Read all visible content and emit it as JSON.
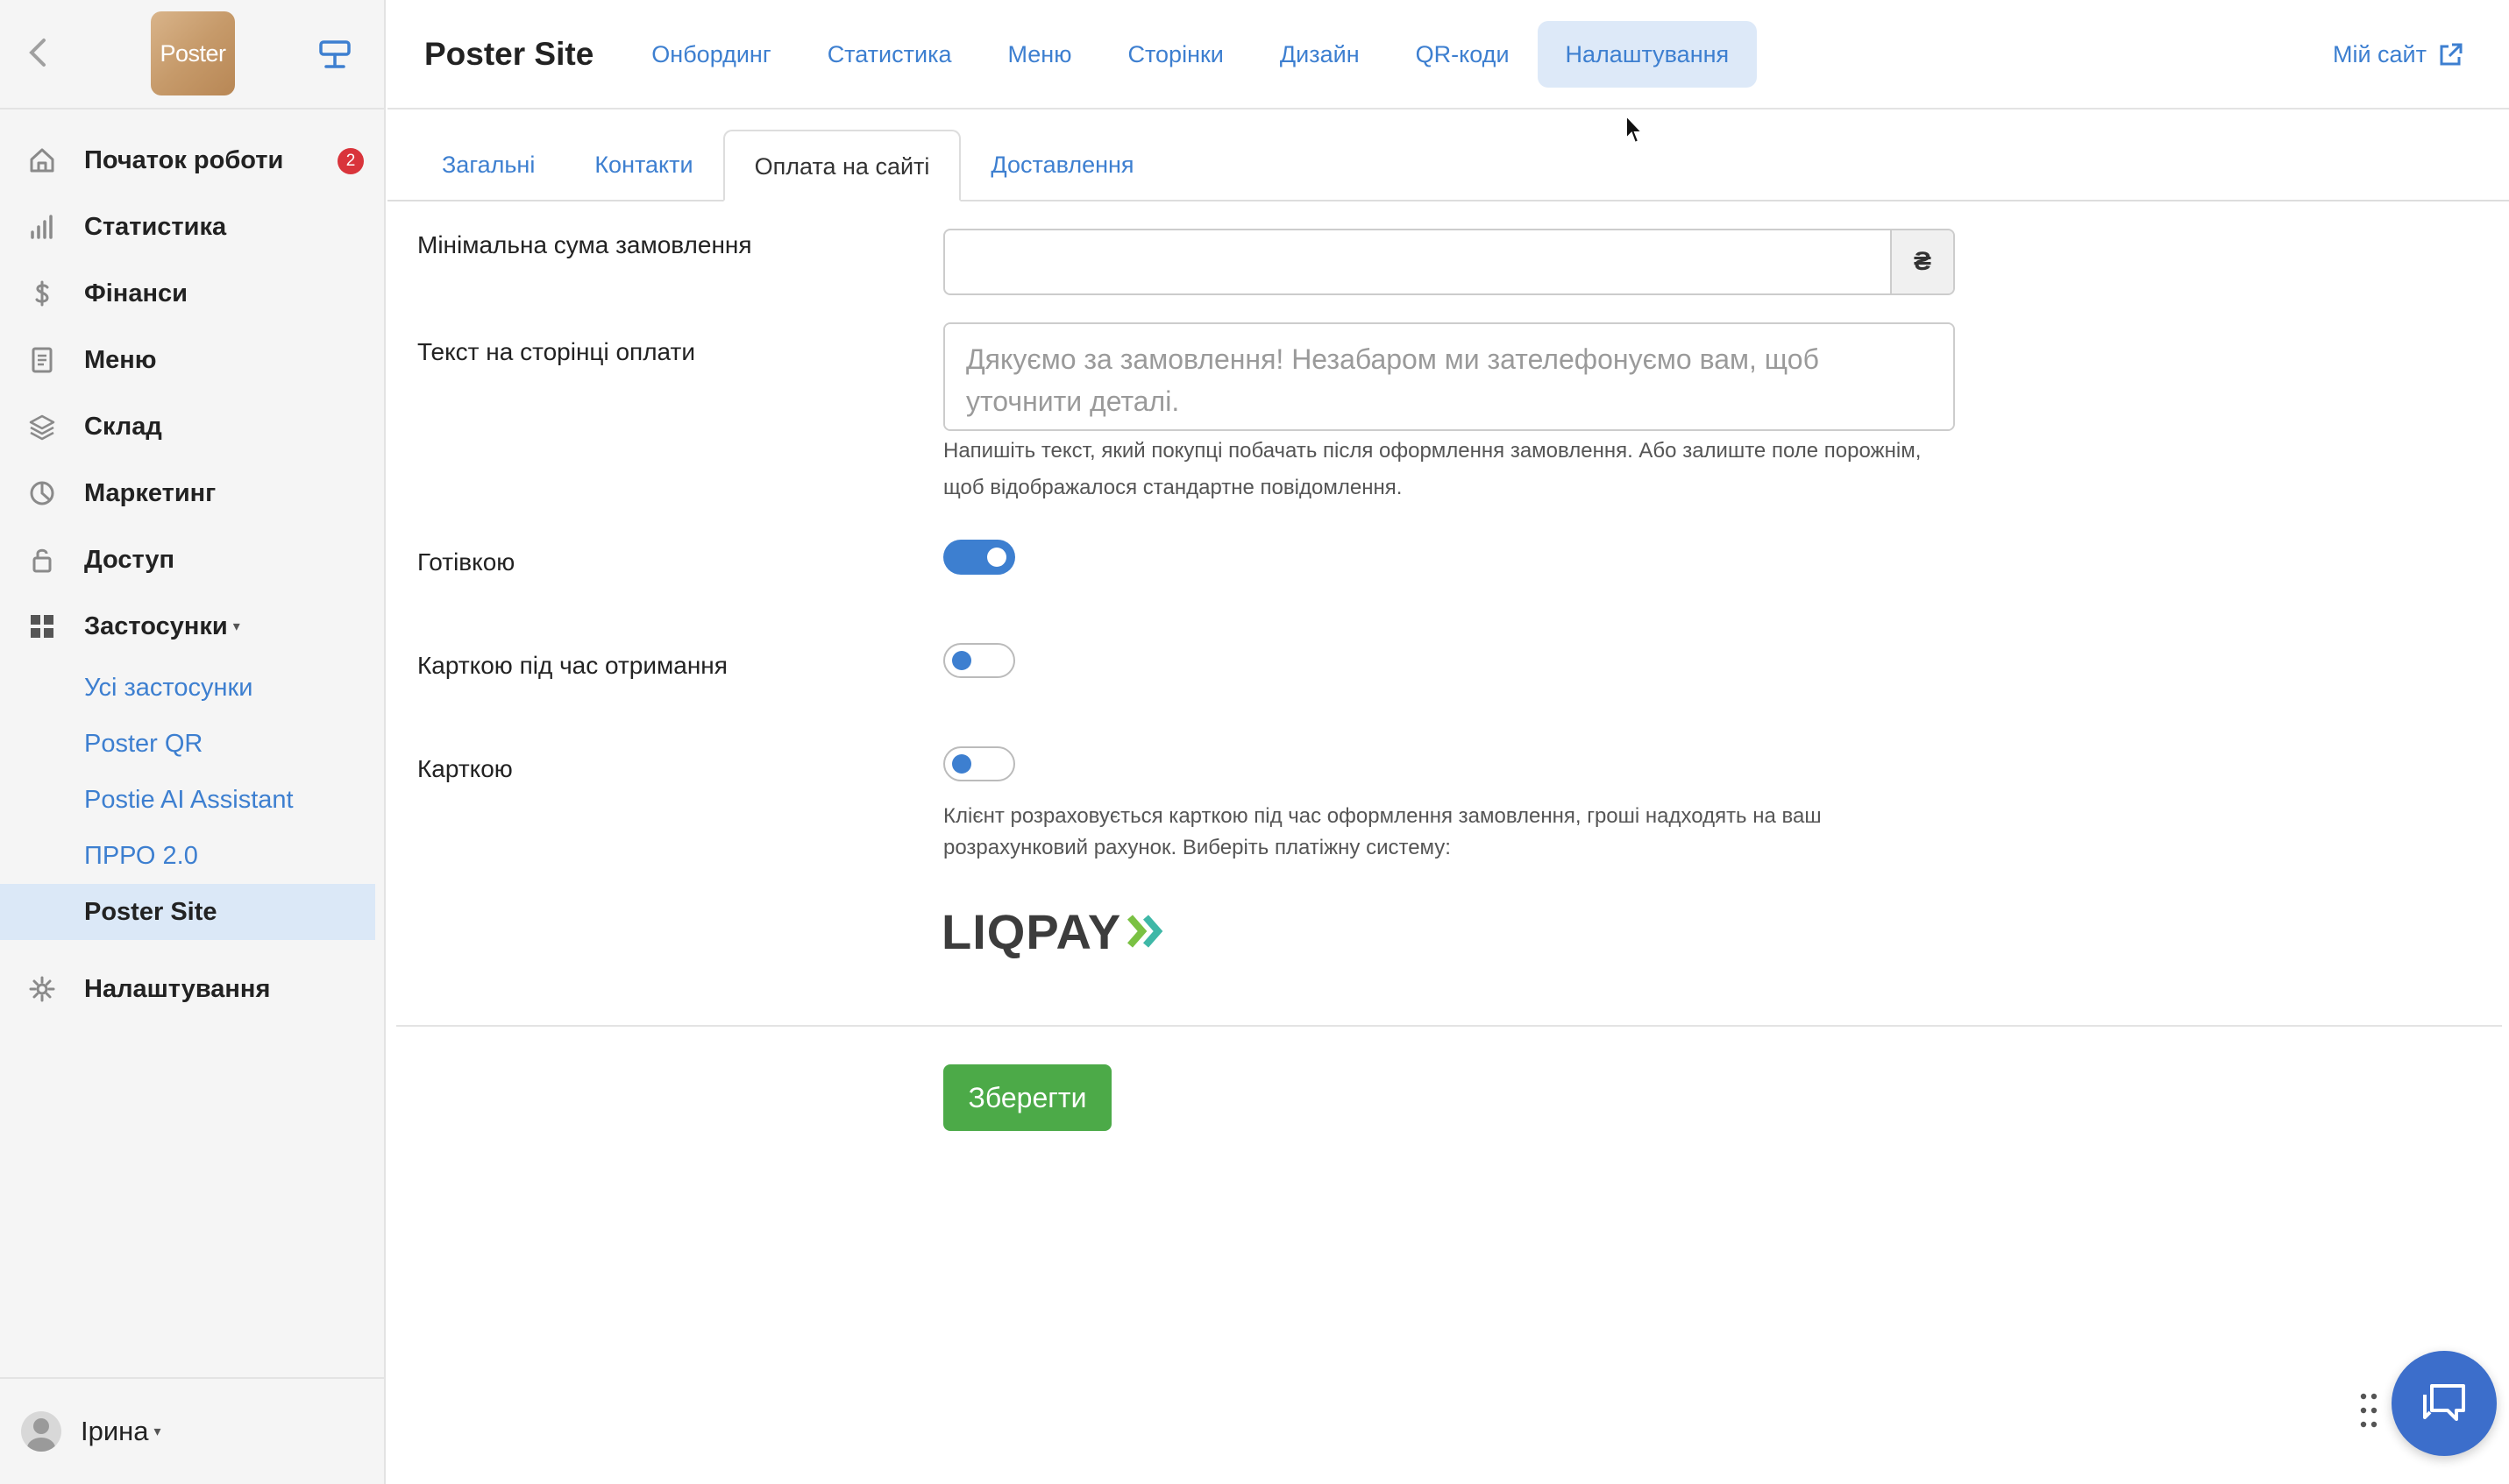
{
  "sidebar": {
    "logo_text": "Poster",
    "items": [
      {
        "label": "Початок роботи",
        "icon": "home-icon",
        "badge": "2"
      },
      {
        "label": "Статистика",
        "icon": "bar-chart-icon"
      },
      {
        "label": "Фінанси",
        "icon": "dollar-icon"
      },
      {
        "label": "Меню",
        "icon": "document-icon"
      },
      {
        "label": "Склад",
        "icon": "layers-icon"
      },
      {
        "label": "Маркетинг",
        "icon": "pie-chart-icon"
      },
      {
        "label": "Доступ",
        "icon": "lock-icon"
      },
      {
        "label": "Застосунки",
        "icon": "grid-icon"
      }
    ],
    "apps_sub": [
      "Усі застосунки",
      "Poster QR",
      "Postie AI Assistant",
      "ПРРО 2.0",
      "Poster Site"
    ],
    "settings_label": "Налаштування",
    "user_name": "Ірина"
  },
  "topbar": {
    "title": "Poster Site",
    "nav": [
      "Онбординг",
      "Статистика",
      "Меню",
      "Сторінки",
      "Дизайн",
      "QR-коди",
      "Налаштування"
    ],
    "active_nav": "Налаштування",
    "my_site": "Мій сайт"
  },
  "tabs": [
    "Загальні",
    "Контакти",
    "Оплата на сайті",
    "Доставлення"
  ],
  "active_tab": "Оплата на сайті",
  "form": {
    "min_amount_label": "Мінімальна сума замовлення",
    "min_amount_value": "",
    "currency": "₴",
    "payment_text_label": "Текст на сторінці оплати",
    "payment_text_placeholder": "Дякуємо за замовлення! Незабаром ми зателефонуємо вам, щоб уточнити деталі.",
    "payment_text_help_1": "Напишіть текст, який покупці побачать після оформлення замовлення. Або залиште поле порожнім,",
    "payment_text_help_2": "щоб відображалося стандартне повідомлення.",
    "cash_label": "Готівкою",
    "cash_enabled": true,
    "card_on_delivery_label": "Карткою під час отримання",
    "card_on_delivery_enabled": false,
    "card_label": "Карткою",
    "card_enabled": false,
    "card_help_1": "Клієнт розраховується карткою під час оформлення замовлення, гроші надходять на ваш",
    "card_help_2": "розрахунковий рахунок. Виберіть платіжну систему:",
    "payment_system": "LIQPAY",
    "save_label": "Зберегти"
  },
  "colors": {
    "accent": "#3d7fd0",
    "save": "#4caa48",
    "badge": "#d9343b",
    "chat": "#3c6ecb"
  }
}
